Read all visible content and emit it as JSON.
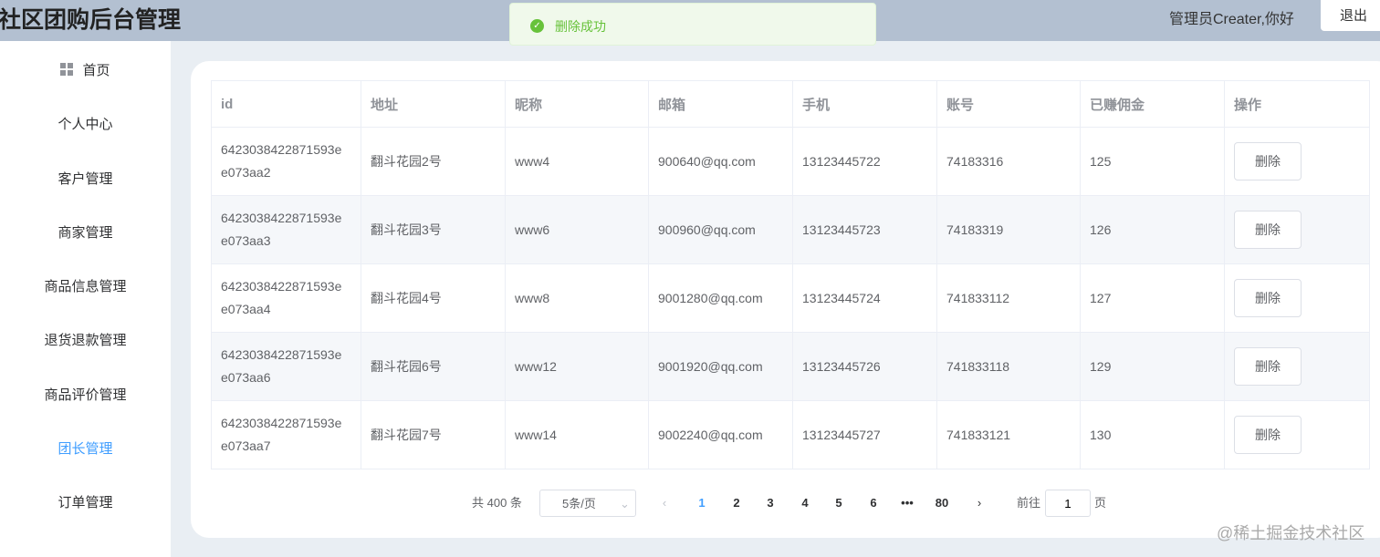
{
  "header": {
    "title": "社区团购后台管理",
    "user": "管理员Creater,你好",
    "logout": "退出"
  },
  "toast": {
    "message": "删除成功"
  },
  "sidebar": {
    "items": [
      {
        "label": "首页"
      },
      {
        "label": "个人中心"
      },
      {
        "label": "客户管理"
      },
      {
        "label": "商家管理"
      },
      {
        "label": "商品信息管理"
      },
      {
        "label": "退货退款管理"
      },
      {
        "label": "商品评价管理"
      },
      {
        "label": "团长管理",
        "active": true
      },
      {
        "label": "订单管理"
      }
    ]
  },
  "table": {
    "columns": [
      "id",
      "地址",
      "昵称",
      "邮箱",
      "手机",
      "账号",
      "已赚佣金",
      "操作"
    ],
    "rows": [
      {
        "id1": "6423038422871593e",
        "id2": "e073aa2",
        "address": "翻斗花园2号",
        "nickname": "www4",
        "email": "900640@qq.com",
        "phone": "13123445722",
        "account": "74183316",
        "commission": "125",
        "action": "删除"
      },
      {
        "id1": "6423038422871593e",
        "id2": "e073aa3",
        "address": "翻斗花园3号",
        "nickname": "www6",
        "email": "900960@qq.com",
        "phone": "13123445723",
        "account": "74183319",
        "commission": "126",
        "action": "删除"
      },
      {
        "id1": "6423038422871593e",
        "id2": "e073aa4",
        "address": "翻斗花园4号",
        "nickname": "www8",
        "email": "9001280@qq.com",
        "phone": "13123445724",
        "account": "741833112",
        "commission": "127",
        "action": "删除"
      },
      {
        "id1": "6423038422871593e",
        "id2": "e073aa6",
        "address": "翻斗花园6号",
        "nickname": "www12",
        "email": "9001920@qq.com",
        "phone": "13123445726",
        "account": "741833118",
        "commission": "129",
        "action": "删除"
      },
      {
        "id1": "6423038422871593e",
        "id2": "e073aa7",
        "address": "翻斗花园7号",
        "nickname": "www14",
        "email": "9002240@qq.com",
        "phone": "13123445727",
        "account": "741833121",
        "commission": "130",
        "action": "删除"
      }
    ]
  },
  "pagination": {
    "total": "共 400 条",
    "page_size": "5条/页",
    "pages": [
      "1",
      "2",
      "3",
      "4",
      "5",
      "6",
      "•••",
      "80"
    ],
    "current": "1",
    "goto_label": "前往",
    "goto_value": "1",
    "page_suffix": "页"
  },
  "watermark": "@稀土掘金技术社区"
}
